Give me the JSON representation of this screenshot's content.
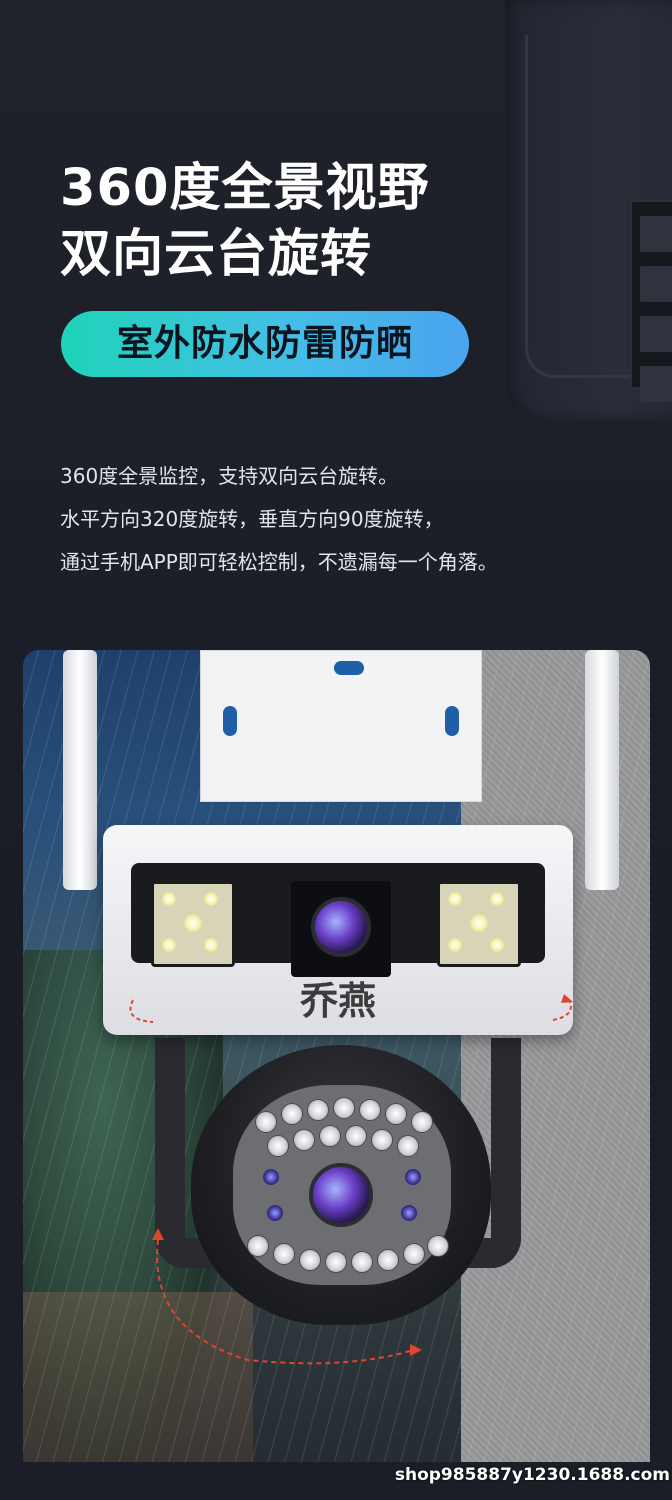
{
  "headline": {
    "line1": "360度全景视野",
    "line2": "双向云台旋转"
  },
  "pill": {
    "label": "室外防水防雷防晒"
  },
  "description": [
    "360度全景监控，支持双向云台旋转。",
    "水平方向320度旋转，垂直方向90度旋转，",
    "通过手机APP即可轻松控制，不遗漏每一个角落。"
  ],
  "product": {
    "brand_mark": "乔燕"
  },
  "watermark": "shop985887y1230.1688.com",
  "colors": {
    "background": "#1d2029",
    "pill_gradient_start": "#1fd3b8",
    "pill_gradient_end": "#4aa4ef",
    "arrow": "#e0452f"
  }
}
